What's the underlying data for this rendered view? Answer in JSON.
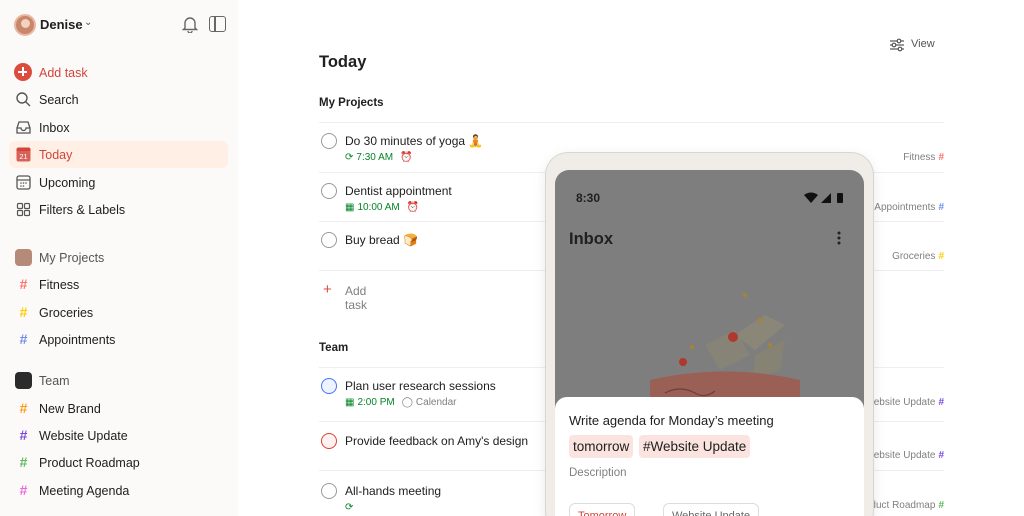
{
  "user": {
    "name": "Denise"
  },
  "nav": [
    {
      "label": "Add task",
      "icon": "plus-circle-icon"
    },
    {
      "label": "Search",
      "icon": "search-icon"
    },
    {
      "label": "Inbox",
      "icon": "inbox-icon"
    },
    {
      "label": "Today",
      "icon": "calendar-today-icon",
      "day": "21"
    },
    {
      "label": "Upcoming",
      "icon": "calendar-grid-icon"
    },
    {
      "label": "Filters & Labels",
      "icon": "grid-icon"
    }
  ],
  "my_projects": {
    "label": "My Projects",
    "items": [
      {
        "label": "Fitness",
        "color": "#ff7066"
      },
      {
        "label": "Groceries",
        "color": "#ffcc00"
      },
      {
        "label": "Appointments",
        "color": "#6b8ee8"
      }
    ]
  },
  "team": {
    "label": "Team",
    "items": [
      {
        "label": "New Brand",
        "color": "#ff9a14"
      },
      {
        "label": "Website Update",
        "color": "#7a48e0"
      },
      {
        "label": "Product Roadmap",
        "color": "#5cb85c"
      },
      {
        "label": "Meeting Agenda",
        "color": "#e86bd6"
      }
    ]
  },
  "main": {
    "title": "Today",
    "view_label": "View",
    "sections": [
      {
        "title": "My Projects"
      },
      {
        "title": "Team"
      }
    ],
    "add_task_label": "Add task",
    "tasks": [
      {
        "title": "Do 30 minutes of yoga 🧘",
        "time": "7:30 AM",
        "project": "Fitness",
        "project_color": "#ff7066"
      },
      {
        "title": "Dentist appointment",
        "time": "10:00 AM",
        "project": "Appointments",
        "project_color": "#6b8ee8"
      },
      {
        "title": "Buy bread 🍞",
        "project": "Groceries",
        "project_color": "#ffcc00"
      },
      {
        "title": "Plan user research sessions",
        "time": "2:00 PM",
        "extra": "Calendar",
        "project": "Website Update",
        "project_color": "#7a48e0"
      },
      {
        "title": "Provide feedback on Amy's design",
        "project": "Website Update",
        "project_color": "#7a48e0"
      },
      {
        "title": "All-hands meeting",
        "project": "Product Roadmap",
        "project_color": "#5cb85c"
      }
    ]
  },
  "phone": {
    "time": "8:30",
    "title": "Inbox",
    "sheet_title": "Write agenda for Monday’s meeting",
    "chips": [
      "tomorrow",
      "#Website Update"
    ],
    "description": "Description",
    "pills": [
      "Tomorrow",
      "Website Update"
    ]
  }
}
